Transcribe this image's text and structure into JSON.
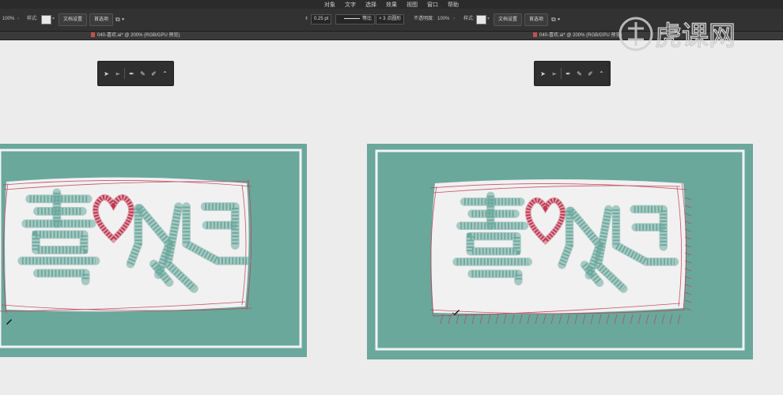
{
  "menubar": {
    "items": [
      "对象",
      "文字",
      "选择",
      "效果",
      "视图",
      "窗口",
      "帮助"
    ]
  },
  "controlbar": {
    "left": {
      "opacity": "100%",
      "style_label": "样式:",
      "doc_setup": "文档设置",
      "preferences": "首选项"
    },
    "middle": {
      "stroke_weight": "0.25 pt",
      "stroke_profile": "等比",
      "brush": "3 点圆形"
    },
    "right": {
      "opacity_label": "不透明度:",
      "opacity": "100%",
      "style_label": "样式:",
      "doc_setup": "文档设置",
      "preferences": "首选项"
    }
  },
  "tabs": {
    "left": "040-喜欢.ai* @ 200% (RGB/GPU 预览)",
    "right": "040-喜欢.ai* @ 200% (RGB/GPU 预览)"
  },
  "watermark": {
    "text": "虎课网"
  },
  "colors": {
    "teal": "#6aa89c",
    "paper": "#f1f1f1",
    "sketch_red": "#c0364f",
    "toolbar": "#323232",
    "menubar": "#2b2b2b"
  },
  "icons": [
    "selection-tool-icon",
    "direct-selection-icon",
    "pen-tool-icon",
    "add-anchor-icon",
    "delete-anchor-icon",
    "anchor-convert-icon"
  ]
}
